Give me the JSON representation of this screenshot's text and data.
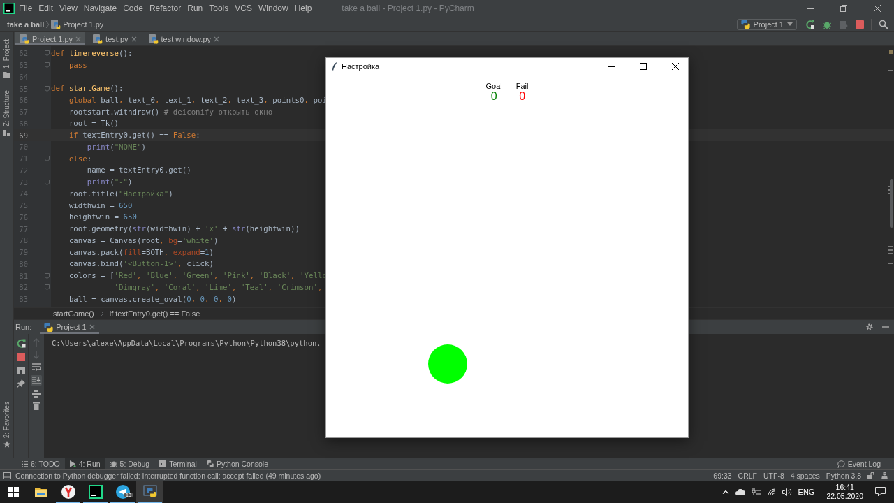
{
  "window": {
    "title": "take a ball - Project 1.py - PyCharm"
  },
  "menu": [
    "File",
    "Edit",
    "View",
    "Navigate",
    "Code",
    "Refactor",
    "Run",
    "Tools",
    "VCS",
    "Window",
    "Help"
  ],
  "navigation": {
    "breadcrumbs": [
      "take a ball",
      "Project 1.py"
    ],
    "run_configuration": "Project 1"
  },
  "editor_tabs": [
    {
      "label": "Project 1.py",
      "selected": true
    },
    {
      "label": "test.py",
      "selected": false
    },
    {
      "label": "test window.py",
      "selected": false
    }
  ],
  "side_tools": {
    "top": [
      "1: Project",
      "Z: Structure"
    ],
    "bottom": [
      "2: Favorites"
    ]
  },
  "editor": {
    "lines": [
      {
        "number": "62",
        "current": false,
        "fold": true,
        "tokens": [
          {
            "kind": "keyword",
            "text": "def "
          },
          {
            "kind": "function",
            "text": "timereverse"
          },
          {
            "kind": "plain",
            "text": "():"
          }
        ]
      },
      {
        "number": "63",
        "current": false,
        "fold": true,
        "tokens": [
          {
            "kind": "keyword",
            "text": "    pass"
          }
        ]
      },
      {
        "number": "64",
        "current": false,
        "fold": false
      },
      {
        "number": "65",
        "current": false,
        "fold": true,
        "tokens": [
          {
            "kind": "keyword",
            "text": "def "
          },
          {
            "kind": "function",
            "text": "startGame"
          },
          {
            "kind": "plain",
            "text": "():"
          }
        ]
      },
      {
        "number": "66",
        "current": false,
        "fold": false,
        "tokens": [
          {
            "kind": "keyword",
            "text": "    global"
          },
          {
            "kind": "plain",
            "text": " ball"
          },
          {
            "kind": "keyword",
            "text": ","
          },
          {
            "kind": "plain",
            "text": " text_0"
          },
          {
            "kind": "keyword",
            "text": ","
          },
          {
            "kind": "plain",
            "text": " text_1"
          },
          {
            "kind": "keyword",
            "text": ","
          },
          {
            "kind": "plain",
            "text": " text_2"
          },
          {
            "kind": "keyword",
            "text": ","
          },
          {
            "kind": "plain",
            "text": " text_3"
          },
          {
            "kind": "keyword",
            "text": ","
          },
          {
            "kind": "plain",
            "text": " points0"
          },
          {
            "kind": "keyword",
            "text": ","
          },
          {
            "kind": "plain",
            "text": " poi"
          }
        ]
      },
      {
        "number": "67",
        "current": false,
        "fold": false,
        "tokens": [
          {
            "kind": "plain",
            "text": "    rootstart.withdraw() "
          },
          {
            "kind": "comment",
            "text": "# deiconify открыть окно"
          }
        ]
      },
      {
        "number": "68",
        "current": false,
        "fold": false,
        "tokens": [
          {
            "kind": "plain",
            "text": "    root = Tk()"
          }
        ]
      },
      {
        "number": "69",
        "current": true,
        "fold": false,
        "tokens": [
          {
            "kind": "keyword",
            "text": "    if"
          },
          {
            "kind": "plain",
            "text": " textEntry0.get() == "
          },
          {
            "kind": "keyword",
            "text": "False"
          },
          {
            "kind": "plain",
            "text": ":"
          }
        ]
      },
      {
        "number": "70",
        "current": false,
        "fold": false,
        "tokens": [
          {
            "kind": "builtin",
            "text": "        print"
          },
          {
            "kind": "plain",
            "text": "("
          },
          {
            "kind": "string",
            "text": "\"NONE\""
          },
          {
            "kind": "plain",
            "text": ")"
          }
        ]
      },
      {
        "number": "71",
        "current": false,
        "fold": true,
        "tokens": [
          {
            "kind": "keyword",
            "text": "    else"
          },
          {
            "kind": "plain",
            "text": ":"
          }
        ]
      },
      {
        "number": "72",
        "current": false,
        "fold": false,
        "tokens": [
          {
            "kind": "plain",
            "text": "        name = textEntry0.get()"
          }
        ]
      },
      {
        "number": "73",
        "current": false,
        "fold": true,
        "tokens": [
          {
            "kind": "builtin",
            "text": "        print"
          },
          {
            "kind": "plain",
            "text": "("
          },
          {
            "kind": "string",
            "text": "\"-\""
          },
          {
            "kind": "plain",
            "text": ")"
          }
        ]
      },
      {
        "number": "74",
        "current": false,
        "fold": false,
        "tokens": [
          {
            "kind": "plain",
            "text": "    root.title("
          },
          {
            "kind": "string",
            "text": "\"Настройка\""
          },
          {
            "kind": "plain",
            "text": ")"
          }
        ]
      },
      {
        "number": "75",
        "current": false,
        "fold": false,
        "tokens": [
          {
            "kind": "plain",
            "text": "    widthwin = "
          },
          {
            "kind": "number",
            "text": "650"
          }
        ]
      },
      {
        "number": "76",
        "current": false,
        "fold": false,
        "tokens": [
          {
            "kind": "plain",
            "text": "    heightwin = "
          },
          {
            "kind": "number",
            "text": "650"
          }
        ]
      },
      {
        "number": "77",
        "current": false,
        "fold": false,
        "tokens": [
          {
            "kind": "plain",
            "text": "    root.geometry("
          },
          {
            "kind": "builtin",
            "text": "str"
          },
          {
            "kind": "plain",
            "text": "(widthwin) + "
          },
          {
            "kind": "string",
            "text": "'x'"
          },
          {
            "kind": "plain",
            "text": " + "
          },
          {
            "kind": "builtin",
            "text": "str"
          },
          {
            "kind": "plain",
            "text": "(heightwin))"
          }
        ]
      },
      {
        "number": "78",
        "current": false,
        "fold": false,
        "tokens": [
          {
            "kind": "plain",
            "text": "    canvas = Canvas(root"
          },
          {
            "kind": "keyword",
            "text": ", "
          },
          {
            "kind": "param",
            "text": "bg"
          },
          {
            "kind": "plain",
            "text": "="
          },
          {
            "kind": "string",
            "text": "'white'"
          },
          {
            "kind": "plain",
            "text": ")"
          }
        ]
      },
      {
        "number": "79",
        "current": false,
        "fold": false,
        "tokens": [
          {
            "kind": "plain",
            "text": "    canvas.pack("
          },
          {
            "kind": "param",
            "text": "fill"
          },
          {
            "kind": "plain",
            "text": "=BOTH"
          },
          {
            "kind": "keyword",
            "text": ", "
          },
          {
            "kind": "param",
            "text": "expand"
          },
          {
            "kind": "plain",
            "text": "="
          },
          {
            "kind": "number",
            "text": "1"
          },
          {
            "kind": "plain",
            "text": ")"
          }
        ]
      },
      {
        "number": "80",
        "current": false,
        "fold": false,
        "tokens": [
          {
            "kind": "plain",
            "text": "    canvas.bind("
          },
          {
            "kind": "string",
            "text": "'<Button-1>'"
          },
          {
            "kind": "keyword",
            "text": ","
          },
          {
            "kind": "plain",
            "text": " click)"
          }
        ]
      },
      {
        "number": "81",
        "current": false,
        "fold": true,
        "tokens": [
          {
            "kind": "plain",
            "text": "    colors = ["
          },
          {
            "kind": "string",
            "text": "'Red'"
          },
          {
            "kind": "keyword",
            "text": ", "
          },
          {
            "kind": "string",
            "text": "'Blue'"
          },
          {
            "kind": "keyword",
            "text": ", "
          },
          {
            "kind": "string",
            "text": "'Green'"
          },
          {
            "kind": "keyword",
            "text": ", "
          },
          {
            "kind": "string",
            "text": "'Pink'"
          },
          {
            "kind": "keyword",
            "text": ", "
          },
          {
            "kind": "string",
            "text": "'Black'"
          },
          {
            "kind": "keyword",
            "text": ", "
          },
          {
            "kind": "string",
            "text": "'Yello"
          }
        ]
      },
      {
        "number": "82",
        "current": false,
        "fold": true,
        "tokens": [
          {
            "kind": "string",
            "text": "              'Dimgray'"
          },
          {
            "kind": "keyword",
            "text": ", "
          },
          {
            "kind": "string",
            "text": "'Coral'"
          },
          {
            "kind": "keyword",
            "text": ", "
          },
          {
            "kind": "string",
            "text": "'Lime'"
          },
          {
            "kind": "keyword",
            "text": ", "
          },
          {
            "kind": "string",
            "text": "'Teal'"
          },
          {
            "kind": "keyword",
            "text": ", "
          },
          {
            "kind": "string",
            "text": "'Crimson'"
          },
          {
            "kind": "keyword",
            "text": ","
          }
        ]
      },
      {
        "number": "83",
        "current": false,
        "fold": false,
        "tokens": [
          {
            "kind": "plain",
            "text": "    ball = canvas.create_oval("
          },
          {
            "kind": "number",
            "text": "0"
          },
          {
            "kind": "keyword",
            "text": ", "
          },
          {
            "kind": "number",
            "text": "0"
          },
          {
            "kind": "keyword",
            "text": ", "
          },
          {
            "kind": "number",
            "text": "0"
          },
          {
            "kind": "keyword",
            "text": ", "
          },
          {
            "kind": "number",
            "text": "0"
          },
          {
            "kind": "plain",
            "text": ")"
          }
        ]
      }
    ]
  },
  "code_breadcrumbs": [
    "startGame()",
    "if textEntry0.get() == False"
  ],
  "run_panel": {
    "label": "Run:",
    "tabs": [
      {
        "label": "Project 1",
        "selected": true
      }
    ],
    "console": [
      "C:\\Users\\alexe\\AppData\\Local\\Programs\\Python\\Python38\\python.",
      "-"
    ]
  },
  "tool_windows": [
    {
      "label": "6: TODO",
      "kind": "todo",
      "selected": false
    },
    {
      "label": "4: Run",
      "kind": "run",
      "selected": true
    },
    {
      "label": "5: Debug",
      "kind": "debug",
      "selected": false
    },
    {
      "label": "Terminal",
      "kind": "terminal",
      "selected": false
    },
    {
      "label": "Python Console",
      "kind": "python",
      "selected": false
    }
  ],
  "event_log": "Event Log",
  "status_bar": {
    "message": "Connection to Python debugger failed: Interrupted function call: accept failed (49 minutes ago)",
    "items": [
      "69:33",
      "CRLF",
      "UTF-8",
      "4 spaces",
      "Python 3.8"
    ]
  },
  "taskbar": {
    "apps": [
      {
        "kind": "explorer",
        "running": false,
        "selected": false
      },
      {
        "kind": "browser",
        "running": true,
        "selected": false
      },
      {
        "kind": "pycharm",
        "running": true,
        "selected": false
      },
      {
        "kind": "telegram",
        "running": true,
        "selected": false,
        "badge": "13"
      },
      {
        "kind": "python",
        "running": true,
        "selected": true
      }
    ],
    "language": "ENG",
    "time": "16:41",
    "date": "22.05.2020"
  },
  "tk_window": {
    "title": "Настройка",
    "scores": [
      {
        "label": "Goal",
        "value": "0",
        "color": "#008000"
      },
      {
        "label": "Fail",
        "value": "0",
        "color": "#ff0000"
      }
    ]
  }
}
